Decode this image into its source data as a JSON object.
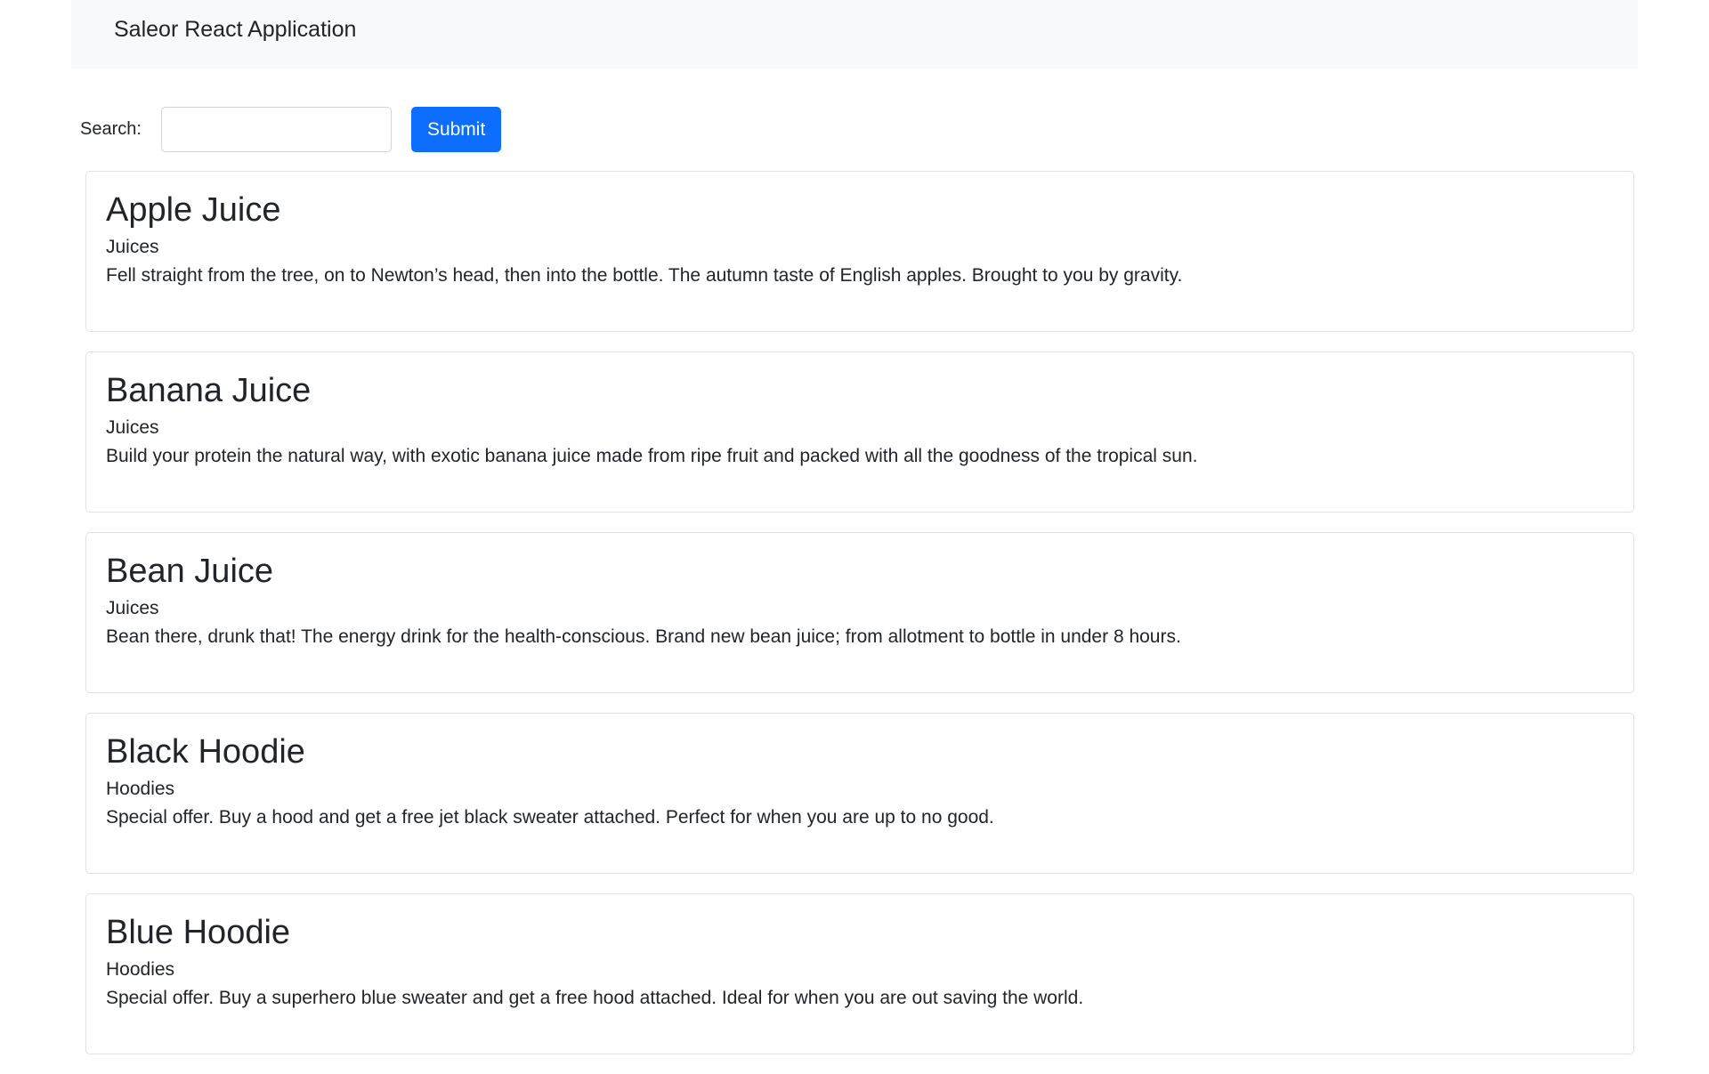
{
  "navbar": {
    "brand": "Saleor React Application"
  },
  "search": {
    "label": "Search:",
    "value": "",
    "placeholder": "",
    "submit_label": "Submit"
  },
  "products": [
    {
      "name": "Apple Juice",
      "category": "Juices",
      "description": "Fell straight from the tree, on to Newton’s head, then into the bottle. The autumn taste of English apples. Brought to you by gravity."
    },
    {
      "name": "Banana Juice",
      "category": "Juices",
      "description": "Build your protein the natural way, with exotic banana juice made from ripe fruit and packed with all the goodness of the tropical sun."
    },
    {
      "name": "Bean Juice",
      "category": "Juices",
      "description": "Bean there, drunk that! The energy drink for the health-conscious. Brand new bean juice; from allotment to bottle in under 8 hours."
    },
    {
      "name": "Black Hoodie",
      "category": "Hoodies",
      "description": "Special offer. Buy a hood and get a free jet black sweater attached. Perfect for when you are up to no good."
    },
    {
      "name": "Blue Hoodie",
      "category": "Hoodies",
      "description": "Special offer. Buy a superhero blue sweater and get a free hood attached. Ideal for when you are out saving the world."
    }
  ],
  "colors": {
    "primary": "#0d6efd",
    "navbar_bg": "#f8f9fa",
    "border": "#dee2e6",
    "text": "#212529"
  }
}
